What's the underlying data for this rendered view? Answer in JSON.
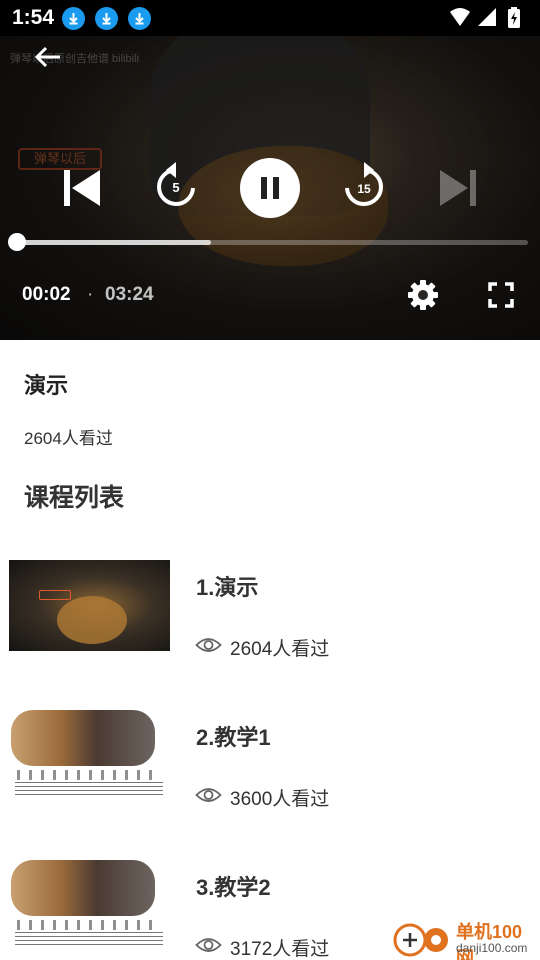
{
  "status_bar": {
    "time": "1:54",
    "download_icons": [
      "download-icon",
      "download-icon",
      "download-icon"
    ],
    "right_icons": [
      "wifi-icon",
      "signal-icon",
      "battery-charging-icon"
    ]
  },
  "player": {
    "watermark": "弹琴以后原创吉他谱 bilibili",
    "sign_text": "弹琴以后",
    "current_time": "00:02",
    "separator": "·",
    "duration": "03:24",
    "progress_fraction": 0.38,
    "icons": [
      "back-arrow-icon",
      "skip-previous-icon",
      "rewind-5-icon",
      "pause-icon",
      "forward-15-icon",
      "skip-next-icon",
      "settings-gear-icon",
      "fullscreen-icon"
    ],
    "rewind_label": "5",
    "forward_label": "15"
  },
  "info": {
    "title": "演示",
    "views": "2604人看过"
  },
  "course_list": {
    "title": "课程列表",
    "items": [
      {
        "title": "1.演示",
        "views": "2604人看过"
      },
      {
        "title": "2.教学1",
        "views": "3600人看过"
      },
      {
        "title": "3.教学2",
        "views": "3172人看过"
      }
    ]
  },
  "site_watermark": {
    "name": "单机100网",
    "url": "danji100.com"
  },
  "colors": {
    "accent_download": "#1a9bf0",
    "site_orange": "#e0711e"
  }
}
